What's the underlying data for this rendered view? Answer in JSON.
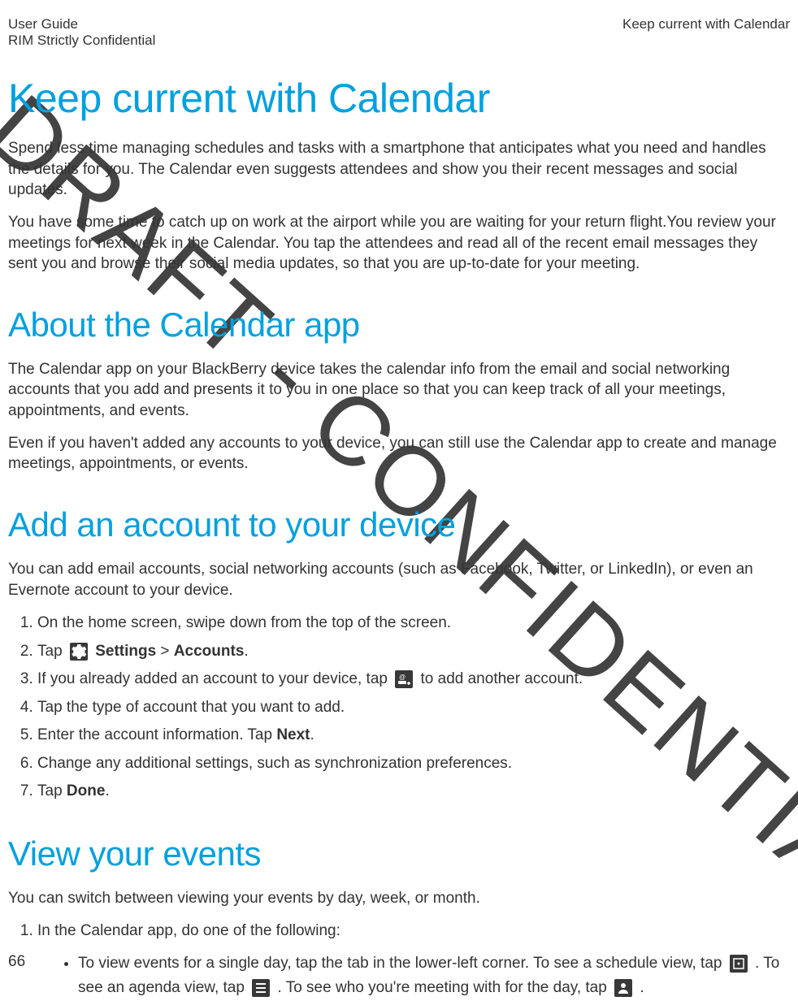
{
  "header": {
    "left_line1": "User Guide",
    "left_line2": "RIM Strictly Confidential",
    "right": "Keep current with Calendar"
  },
  "watermark": "DRAFT - CONFIDENTIAL",
  "h1": "Keep current with Calendar",
  "intro1": "Spend less time managing schedules and tasks with a smartphone that anticipates what you need and handles the details for you. The Calendar even suggests attendees and show you their recent messages and social updates.",
  "intro2": "You have some time to catch up on work at the airport while you are waiting for your return flight.You review your meetings for next week in the Calendar. You tap the attendees and read all of the recent email messages they sent you and browse their social media updates, so that you are up-to-date for your meeting.",
  "about": {
    "title": "About the Calendar app",
    "p1": "The Calendar app on your BlackBerry device takes the calendar info from the email and social networking accounts that you add and presents it to you in one place so that you can keep track of all your meetings, appointments, and events.",
    "p2": "Even if you haven't added any accounts to your device, you can still use the Calendar app to create and manage meetings, appointments, or events."
  },
  "add_account": {
    "title": "Add an account to your device",
    "desc": "You can add email accounts, social networking accounts (such as Facebook, Twitter, or LinkedIn), or even an Evernote account to your device.",
    "step1": "On the home screen, swipe down from the top of the screen.",
    "step2_a": "Tap ",
    "step2_b": " Settings",
    "step2_c": " > ",
    "step2_d": "Accounts",
    "step2_e": ".",
    "step3_a": "If you already added an account to your device, tap ",
    "step3_b": " to add another account.",
    "step4": "Tap the type of account that you want to add.",
    "step5_a": "Enter the account information. Tap ",
    "step5_b": "Next",
    "step5_c": ".",
    "step6": "Change any additional settings, such as synchronization preferences.",
    "step7_a": "Tap ",
    "step7_b": "Done",
    "step7_c": "."
  },
  "view_events": {
    "title": "View your events",
    "desc": "You can switch between viewing your events by day, week, or month.",
    "step1": "In the Calendar app, do one of the following:",
    "bullet_a": "To view events for a single day, tap the tab in the lower-left corner. To see a schedule view, tap ",
    "bullet_b": " . To see an agenda view, tap ",
    "bullet_c": " . To see who you're meeting with for the day, tap ",
    "bullet_d": " ."
  },
  "page_number": "66"
}
